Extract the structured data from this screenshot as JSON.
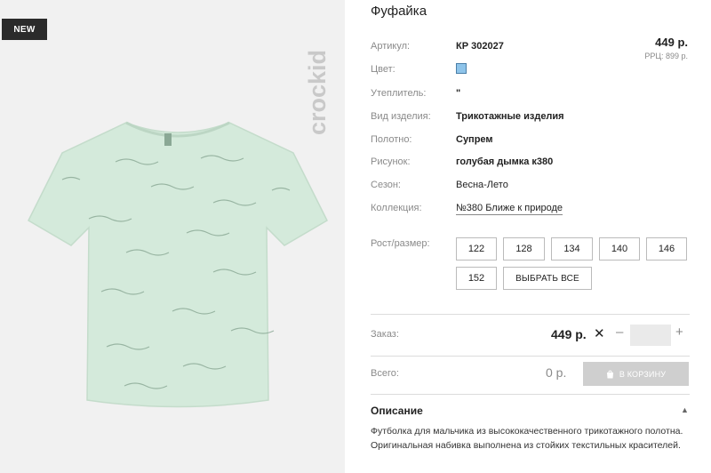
{
  "badge": "NEW",
  "logo_text": "crockid",
  "product": {
    "title": "Фуфайка",
    "price": "449 р.",
    "rrp": "РРЦ: 899 р."
  },
  "attributes": [
    {
      "label": "Артикул:",
      "value": "КР 302027"
    },
    {
      "label": "Цвет:",
      "color": "#8ec4ea"
    },
    {
      "label": "Утеплитель:",
      "value": "\""
    },
    {
      "label": "Вид изделия:",
      "value": "Трикотажные изделия"
    },
    {
      "label": "Полотно:",
      "value": "Супрем"
    },
    {
      "label": "Рисунок:",
      "value": "голубая дымка к380"
    },
    {
      "label": "Сезон:",
      "value": "Весна-Лето"
    },
    {
      "label": "Коллекция:",
      "value": "№380 Ближе к природе"
    }
  ],
  "sizes": {
    "label": "Рост/размер:",
    "options": [
      "122",
      "128",
      "134",
      "140",
      "146",
      "152"
    ],
    "select_all": "ВЫБРАТЬ ВСЕ"
  },
  "order": {
    "label": "Заказ:",
    "price": "449 р.",
    "times": "✕",
    "minus": "–",
    "plus": "+",
    "quantity": ""
  },
  "total": {
    "label": "Всего:",
    "value": "0 р.",
    "cart_button": "В КОРЗИНУ",
    "cart_icon": "shopping-bag-icon"
  },
  "description": {
    "title": "Описание",
    "caret": "▲",
    "text": "Футболка для мальчика из высококачественного трикотажного полотна. Оригинальная набивка выполнена из стойких текстильных красителей."
  },
  "colors": {
    "shirt": "#d4eadb",
    "badge": "#2b2b2b",
    "button_disabled": "#cfcfcf"
  }
}
